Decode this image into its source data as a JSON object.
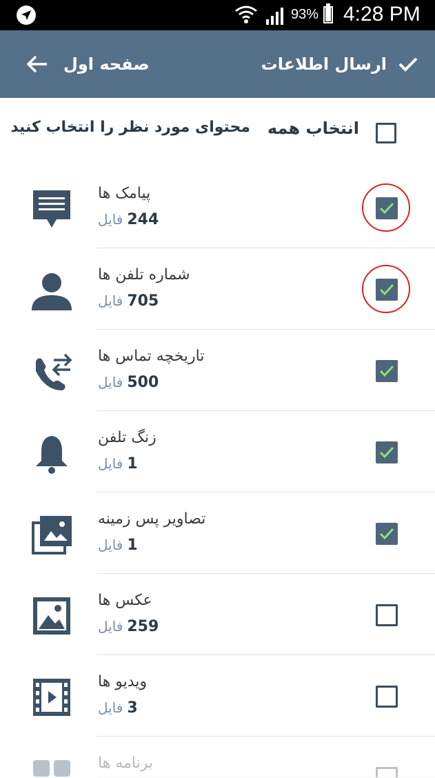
{
  "status_bar": {
    "battery": "93%",
    "time": "4:28 PM"
  },
  "toolbar": {
    "send_label": "ارسال اطلاعات",
    "back_label": "صفحه اول"
  },
  "select_all": {
    "label": "انتخاب همه",
    "hint": "محتوای مورد نظر را انتخاب کنید",
    "checked": false
  },
  "items": [
    {
      "title": "پیامک ها",
      "count": "244",
      "unit": "فایل",
      "checked": true,
      "icon": "message-icon",
      "highlighted": true
    },
    {
      "title": "شماره تلفن ها",
      "count": "705",
      "unit": "فایل",
      "checked": true,
      "icon": "contact-icon",
      "highlighted": true
    },
    {
      "title": "تاریخچه تماس ها",
      "count": "500",
      "unit": "فایل",
      "checked": true,
      "icon": "call-log-icon",
      "highlighted": false
    },
    {
      "title": "زنگ تلفن",
      "count": "1",
      "unit": "فایل",
      "checked": true,
      "icon": "bell-icon",
      "highlighted": false
    },
    {
      "title": "تصاویر پس زمینه",
      "count": "1",
      "unit": "فایل",
      "checked": true,
      "icon": "wallpaper-icon",
      "highlighted": false
    },
    {
      "title": "عکس ها",
      "count": "259",
      "unit": "فایل",
      "checked": false,
      "icon": "photo-icon",
      "highlighted": false
    },
    {
      "title": "ویدیو ها",
      "count": "3",
      "unit": "فایل",
      "checked": false,
      "icon": "video-icon",
      "highlighted": false
    },
    {
      "title": "برنامه ها",
      "count": "",
      "unit": "",
      "checked": false,
      "icon": "apps-icon",
      "highlighted": false
    }
  ],
  "colors": {
    "toolbar": "#557089",
    "checkbox": "#4f657b",
    "check_mark": "#8ee07a",
    "icon": "#3d5266",
    "highlight_ring": "#e02020"
  }
}
